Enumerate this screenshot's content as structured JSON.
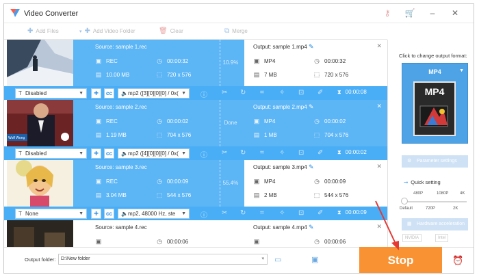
{
  "app": {
    "title": "Video Converter"
  },
  "toolbar": {
    "add_files": "Add Files",
    "add_video_folder": "Add Video Folder",
    "clear": "Clear",
    "merge": "Merge"
  },
  "items": [
    {
      "source": "Source: sample 1.rec",
      "src_format": "REC",
      "src_duration": "00:00:32",
      "src_size": "10.00 MB",
      "src_res": "720 x 576",
      "progress": "10.9%",
      "output": "Output: sample 1.mp4",
      "out_format": "MP4",
      "out_duration": "00:00:32",
      "out_size": "7 MB",
      "out_res": "720 x 576",
      "subtitle": "Disabled",
      "audio": "mp2 ([3][0][0][0] / 0x(",
      "clip_duration": "00:00:08"
    },
    {
      "source": "Source: sample 2.rec",
      "src_format": "REC",
      "src_duration": "00:00:02",
      "src_size": "1.19 MB",
      "src_res": "704 x 576",
      "progress": "Done",
      "output": "Output: sample 2.mp4",
      "out_format": "MP4",
      "out_duration": "00:00:02",
      "out_size": "1 MB",
      "out_res": "704 x 576",
      "subtitle": "Disabled",
      "audio": "mp2 ([4][0][0][0] / 0x(",
      "clip_duration": "00:00:02"
    },
    {
      "source": "Source: sample 3.rec",
      "src_format": "REC",
      "src_duration": "00:00:09",
      "src_size": "3.04 MB",
      "src_res": "544 x 576",
      "progress": "55.4%",
      "output": "Output: sample 3.mp4",
      "out_format": "MP4",
      "out_duration": "00:00:09",
      "out_size": "2 MB",
      "out_res": "544 x 576",
      "subtitle": "None",
      "audio": "mp2, 48000 Hz, ste",
      "clip_duration": "00:00:09"
    },
    {
      "source": "Source: sample 4.rec",
      "src_duration": "00:00:06",
      "output": "Output: sample 4.mp4",
      "out_duration": "00:00:06"
    }
  ],
  "thumb_caption": "Wolf Wong",
  "sidebar": {
    "click_to_change": "Click to change output format:",
    "format": "MP4",
    "param_settings": "Parameter settings",
    "quick_setting": "Quick setting",
    "quality_top": [
      "480P",
      "1080P",
      "4K"
    ],
    "quality_bottom": [
      "Default",
      "720P",
      "2K"
    ],
    "hw_accel": "Hardware acceleration",
    "gpu": [
      "NVIDIA",
      "Intel"
    ]
  },
  "footer": {
    "output_folder_label": "Output folder:",
    "output_folder_value": "D:\\New folder",
    "stop": "Stop"
  },
  "colors": {
    "accent": "#5cb5f5",
    "stop": "#f99233",
    "arrow": "#e53935"
  }
}
